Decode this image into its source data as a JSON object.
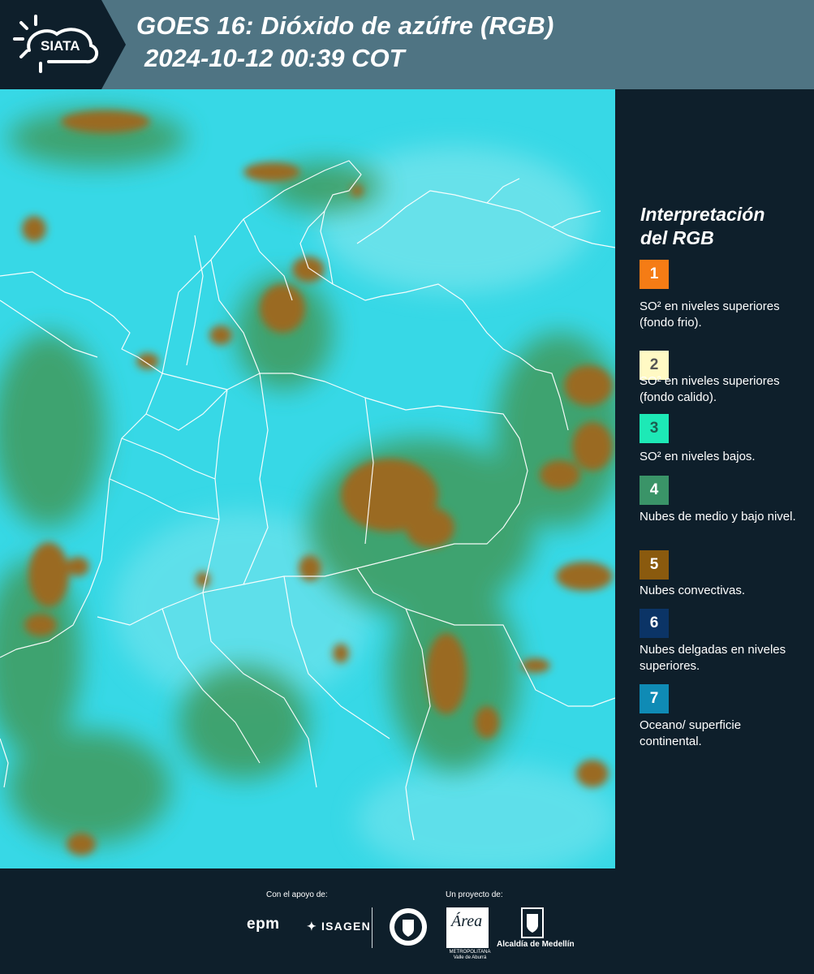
{
  "header": {
    "logo_text": "SIATA",
    "title_line1": "GOES 16: Dióxido de azúfre (RGB)",
    "title_line2": "2024-10-12 00:39 COT"
  },
  "legend": {
    "title_line1": "Interpretación",
    "title_line2": "del RGB",
    "items": [
      {
        "number": "1",
        "color": "#f57c15",
        "text_color": "#ffffff",
        "label": "SO² en niveles superiores (fondo frio)."
      },
      {
        "number": "2",
        "color": "#fff9c4",
        "text_color": "#555555",
        "label": "SO² en niveles superiores (fondo calido)."
      },
      {
        "number": "3",
        "color": "#1de9b6",
        "text_color": "#1b5e50",
        "label": "SO² en niveles bajos."
      },
      {
        "number": "4",
        "color": "#3a9468",
        "text_color": "#ffffff",
        "label": "Nubes de medio y bajo nivel."
      },
      {
        "number": "5",
        "color": "#8a5a0e",
        "text_color": "#ffffff",
        "label": "Nubes convectivas."
      },
      {
        "number": "6",
        "color": "#0b3466",
        "text_color": "#ffffff",
        "label": "Nubes delgadas en niveles superiores."
      },
      {
        "number": "7",
        "color": "#0f8bb5",
        "text_color": "#ffffff",
        "label": "Oceano/ superficie continental."
      }
    ]
  },
  "footer": {
    "support_label": "Con el apoyo de:",
    "project_label": "Un proyecto de:",
    "sponsor_epm": "epm",
    "sponsor_isagen": "ISAGEN",
    "area_word": "Área",
    "area_subtitle": "METROPOLITANA Valle de Aburrá",
    "alcaldia": "Alcaldía de Medellín"
  },
  "colors": {
    "header_bg": "#4f7483",
    "panel_bg": "#0e1f2b",
    "sea_cyan": "#33d6e4",
    "cloud_green": "#3f9a5c",
    "cloud_brown": "#9a6a24"
  }
}
